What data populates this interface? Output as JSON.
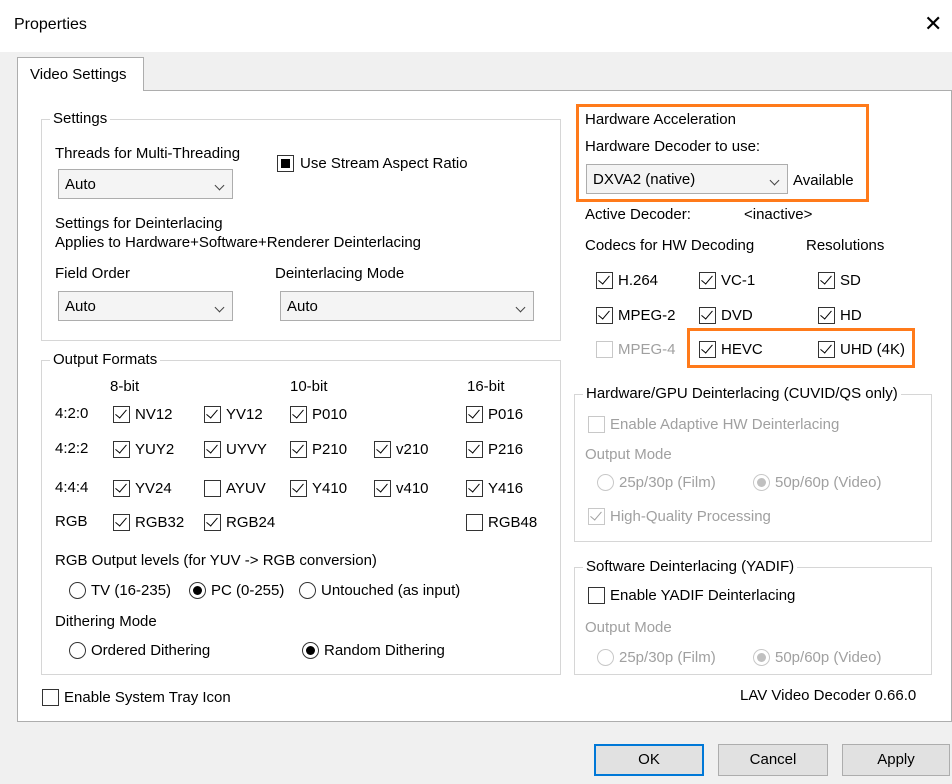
{
  "window": {
    "title": "Properties",
    "close": "✕"
  },
  "tabs": [
    "Video Settings"
  ],
  "settings": {
    "group": "Settings",
    "threads_label": "Threads for Multi-Threading",
    "threads_value": "Auto",
    "stream_aspect": "Use Stream Aspect Ratio",
    "deint_title": "Settings for Deinterlacing",
    "deint_sub": "Applies to Hardware+Software+Renderer Deinterlacing",
    "field_order_label": "Field Order",
    "field_order_value": "Auto",
    "deint_mode_label": "Deinterlacing Mode",
    "deint_mode_value": "Auto"
  },
  "output": {
    "group": "Output Formats",
    "col_8bit": "8-bit",
    "col_10bit": "10-bit",
    "col_16bit": "16-bit",
    "rows": [
      "4:2:0",
      "4:2:2",
      "4:4:4",
      "RGB"
    ],
    "formats": {
      "NV12": "NV12",
      "YV12": "YV12",
      "P010": "P010",
      "P016": "P016",
      "YUY2": "YUY2",
      "UYVY": "UYVY",
      "P210": "P210",
      "v210": "v210",
      "P216": "P216",
      "YV24": "YV24",
      "AYUV": "AYUV",
      "Y410": "Y410",
      "v410": "v410",
      "Y416": "Y416",
      "RGB32": "RGB32",
      "RGB24": "RGB24",
      "RGB48": "RGB48"
    },
    "rgb_levels_label": "RGB Output levels (for YUV -> RGB conversion)",
    "rgb_tv": "TV (16-235)",
    "rgb_pc": "PC (0-255)",
    "rgb_untouched": "Untouched (as input)",
    "dither_label": "Dithering Mode",
    "dither_ordered": "Ordered Dithering",
    "dither_random": "Random Dithering"
  },
  "tray": "Enable System Tray Icon",
  "hw": {
    "group": "Hardware Acceleration",
    "decoder_label": "Hardware Decoder to use:",
    "decoder_value": "DXVA2 (native)",
    "available": "Available",
    "active_label": "Active Decoder:",
    "active_value": "<inactive>",
    "codecs_label": "Codecs for HW Decoding",
    "resolutions_label": "Resolutions",
    "codecs": {
      "h264": "H.264",
      "vc1": "VC-1",
      "mpeg2": "MPEG-2",
      "dvd": "DVD",
      "mpeg4": "MPEG-4",
      "hevc": "HEVC"
    },
    "res": {
      "sd": "SD",
      "hd": "HD",
      "uhd": "UHD (4K)"
    }
  },
  "hwdeint": {
    "group": "Hardware/GPU Deinterlacing (CUVID/QS only)",
    "adaptive": "Enable Adaptive HW Deinterlacing",
    "output_mode": "Output Mode",
    "film": "25p/30p (Film)",
    "video": "50p/60p (Video)",
    "hq": "High-Quality Processing"
  },
  "swdeint": {
    "group": "Software Deinterlacing (YADIF)",
    "enable": "Enable YADIF Deinterlacing",
    "output_mode": "Output Mode",
    "film": "25p/30p (Film)",
    "video": "50p/60p (Video)"
  },
  "version": "LAV Video Decoder 0.66.0",
  "buttons": {
    "ok": "OK",
    "cancel": "Cancel",
    "apply": "Apply"
  },
  "colors": {
    "highlight": "#ff7a1a",
    "default_button": "#0078d7"
  }
}
